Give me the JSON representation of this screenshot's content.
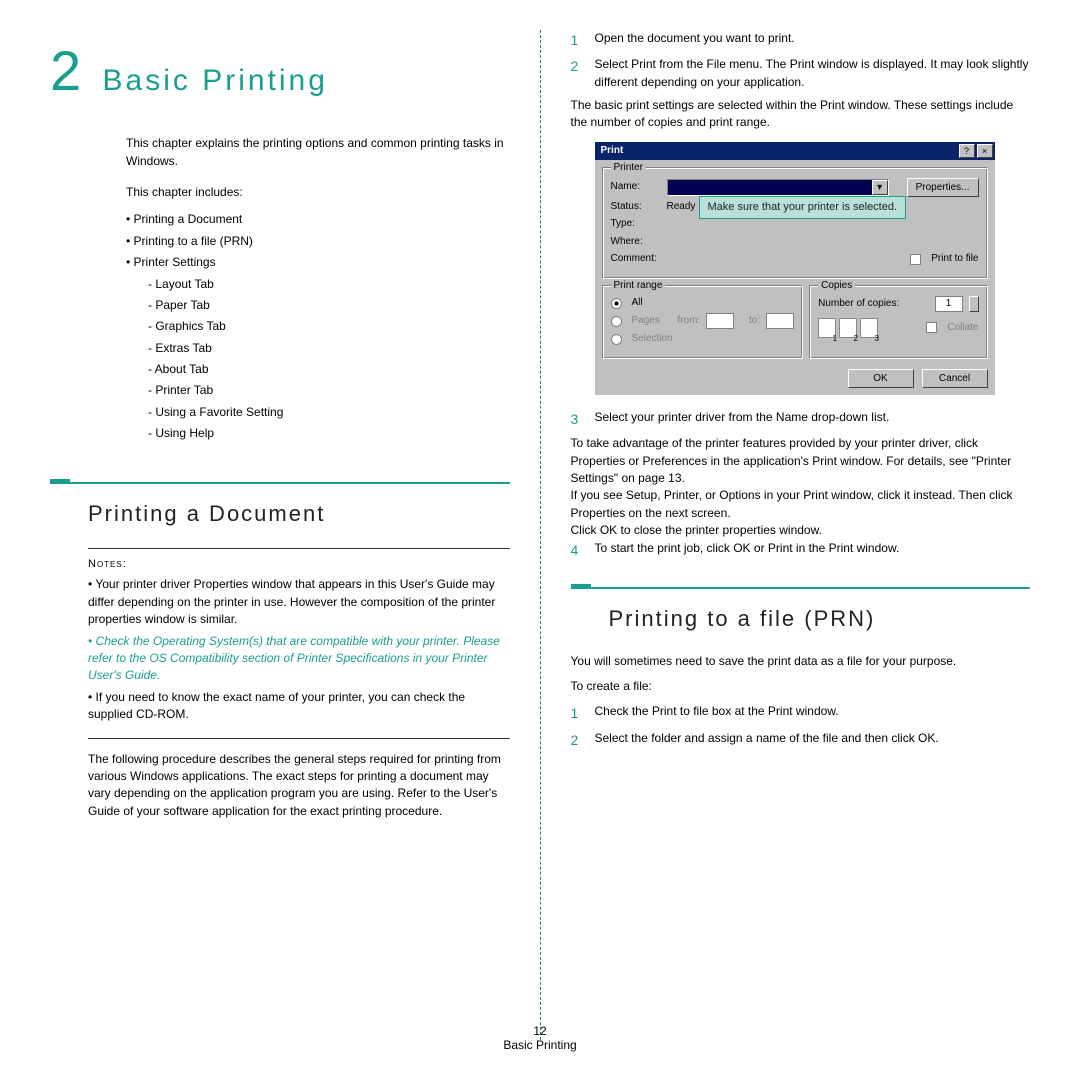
{
  "chapter": {
    "number": "2",
    "title": "Basic Printing"
  },
  "intro": "This chapter explains the printing options and common printing tasks in Windows.",
  "includes_label": "This chapter includes:",
  "toc": {
    "i1": "Printing a Document",
    "i2": "Printing to a file (PRN)",
    "i3": "Printer Settings",
    "s1": "Layout Tab",
    "s2": "Paper Tab",
    "s3": "Graphics Tab",
    "s4": "Extras Tab",
    "s5": "About Tab",
    "s6": "Printer Tab",
    "s7": "Using a Favorite Setting",
    "s8": "Using Help"
  },
  "sec1_title": "Printing a Document",
  "notes_label": "Notes:",
  "note1": "Your printer driver Properties window that appears in this User's Guide may differ depending on the printer in use. However the composition of the printer properties window is similar.",
  "note2": "Check the Operating System(s) that are compatible with your printer. Please refer to the OS Compatibility section of Printer Specifications in your Printer User's Guide.",
  "note3": "If you need to know the exact name of your printer, you can check the supplied CD-ROM.",
  "body1": "The following procedure describes the general steps required for printing from various Windows applications. The exact steps for printing a document may vary depending on the application program you are using. Refer to the User's Guide of your software application for the exact printing procedure.",
  "step1_num": "1",
  "step1": "Open the document you want to print.",
  "step2_num": "2",
  "step2": "Select Print from the File menu. The Print window is displayed. It may look slightly different depending on your application.",
  "step2b": "The basic print settings are selected within the Print window. These settings include the number of copies and print range.",
  "callout": "Make sure that your printer is selected.",
  "dlg": {
    "title": "Print",
    "help": "?",
    "close": "×",
    "g_printer": "Printer",
    "name": "Name:",
    "prop": "Properties...",
    "status": "Status:",
    "status_v": "Ready",
    "type": "Type:",
    "where": "Where:",
    "comment": "Comment:",
    "ptf": "Print to file",
    "g_range": "Print range",
    "all": "All",
    "pages": "Pages",
    "from": "from:",
    "to": "to:",
    "sel": "Selection",
    "g_copies": "Copies",
    "ncopies": "Number of copies:",
    "one": "1",
    "collate": "Collate",
    "ok": "OK",
    "cancel": "Cancel"
  },
  "step3_num": "3",
  "step3": "Select your printer driver from the Name drop-down list.",
  "step3b": "To take advantage of the printer features provided by your printer driver, click Properties or Preferences in the application's Print window. For details, see \"Printer Settings\" on page 13.",
  "step3c": "If you see Setup, Printer, or Options in your Print window, click it instead. Then click Properties on the next screen.",
  "step3d": "Click OK to close the printer properties window.",
  "step4_num": "4",
  "step4": "To start the print job, click OK or Print in the Print window.",
  "sec2_title": "Printing to a file (PRN)",
  "sec2_p1": "You will sometimes need to save the print data as a file for your purpose.",
  "sec2_p2": "To create a file:",
  "p_step1_num": "1",
  "p_step1": "Check the Print to file box at the Print window.",
  "p_step2_num": "2",
  "p_step2": "Select the folder and assign a name of the file and then click OK.",
  "footer_page": "12",
  "footer_title": "Basic Printing"
}
